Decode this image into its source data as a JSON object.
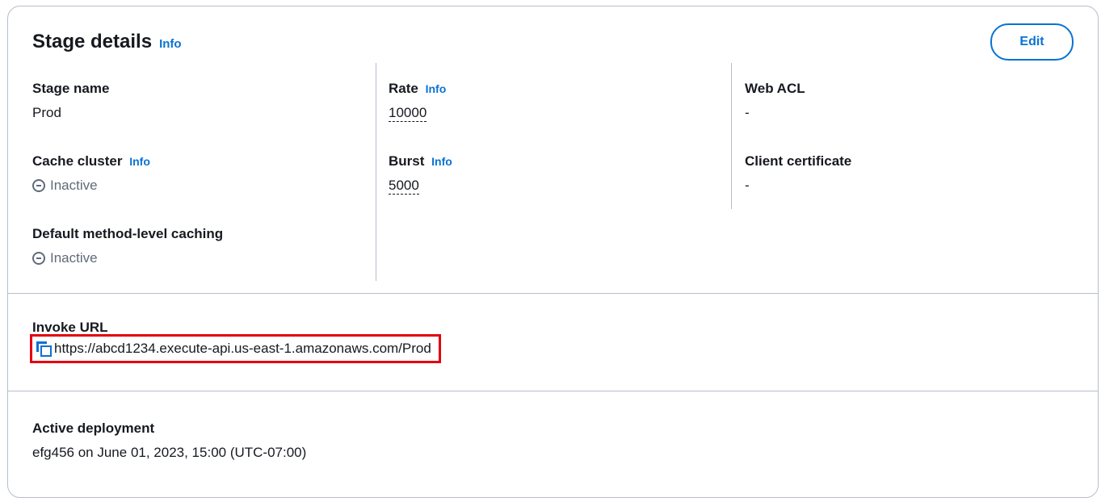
{
  "header": {
    "title": "Stage details",
    "info": "Info",
    "edit_label": "Edit"
  },
  "fields": {
    "stage_name": {
      "label": "Stage name",
      "value": "Prod"
    },
    "cache_cluster": {
      "label": "Cache cluster",
      "info": "Info",
      "value": "Inactive",
      "icon": "status-stopped-icon"
    },
    "default_caching": {
      "label": "Default method-level caching",
      "value": "Inactive",
      "icon": "status-stopped-icon"
    },
    "rate": {
      "label": "Rate",
      "info": "Info",
      "value": "10000"
    },
    "burst": {
      "label": "Burst",
      "info": "Info",
      "value": "5000"
    },
    "web_acl": {
      "label": "Web ACL",
      "value": "-"
    },
    "client_certificate": {
      "label": "Client certificate",
      "value": "-"
    }
  },
  "invoke_url": {
    "label": "Invoke URL",
    "value": "https://abcd1234.execute-api.us-east-1.amazonaws.com/Prod",
    "icon": "copy-icon"
  },
  "active_deployment": {
    "label": "Active deployment",
    "value": "efg456 on June 01, 2023, 15:00 (UTC-07:00)"
  },
  "colors": {
    "link": "#0972d3",
    "text": "#16191f",
    "muted": "#5f6b7a",
    "border": "#b6bec9",
    "highlight": "#e3000f"
  }
}
